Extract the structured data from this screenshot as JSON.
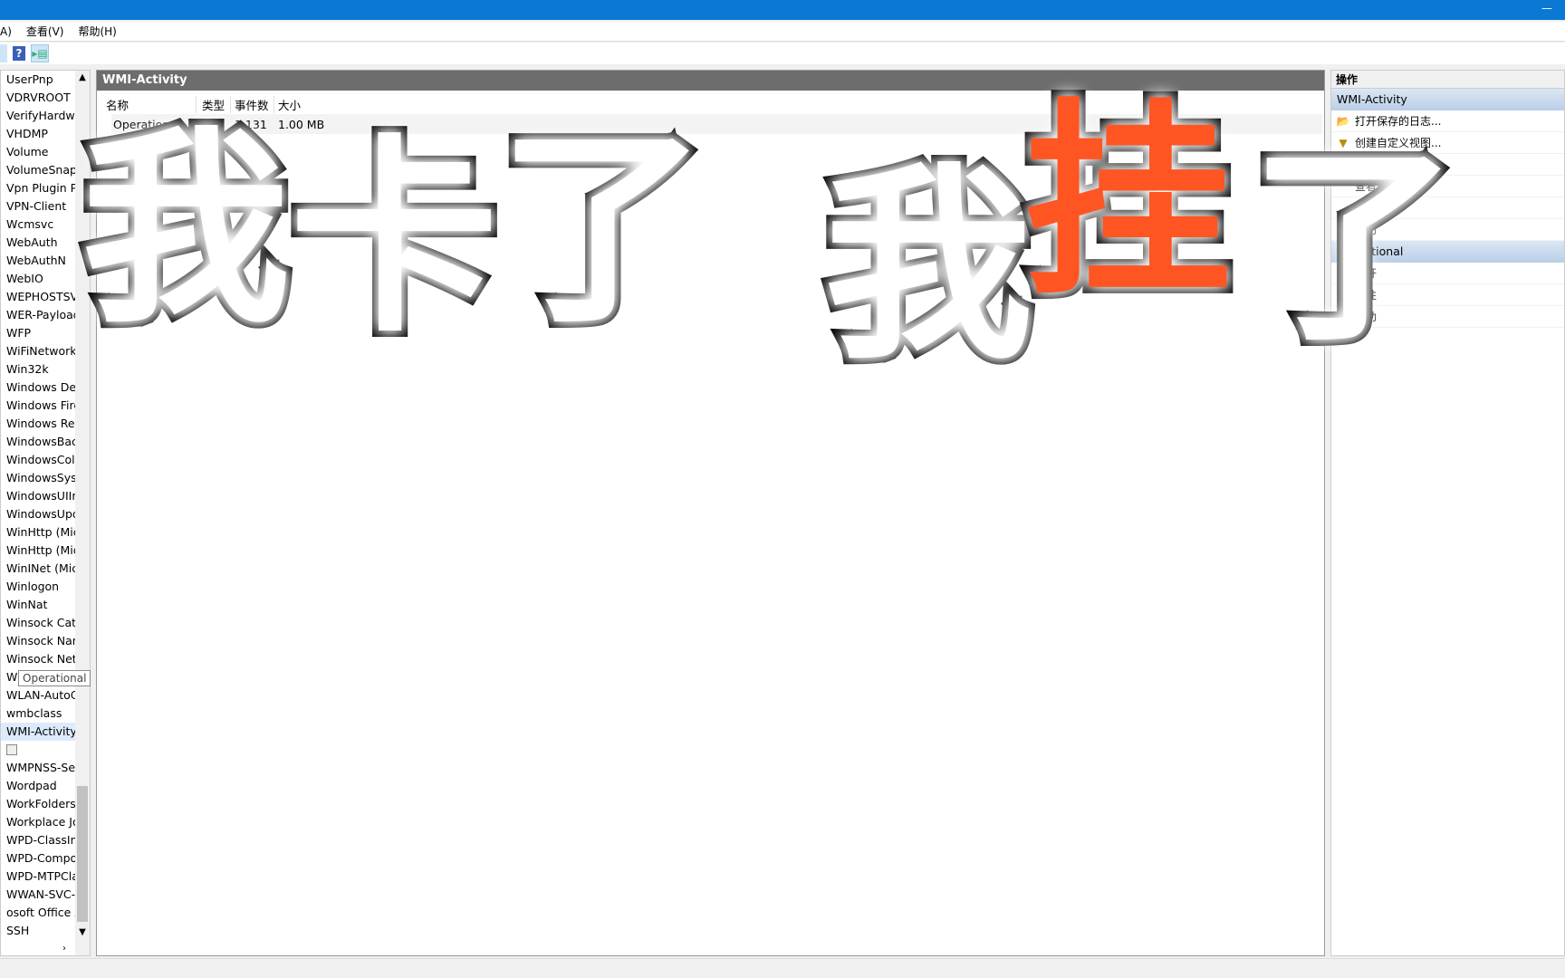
{
  "menu": [
    "A)",
    "查看(V)",
    "帮助(H)"
  ],
  "tree": {
    "items": [
      "UserPnp",
      "VDRVROOT",
      "VerifyHardwa",
      "VHDMP",
      "Volume",
      "VolumeSnaps",
      "Vpn Plugin Pl",
      "VPN-Client",
      "Wcmsvc",
      "WebAuth",
      "WebAuthN",
      "WebIO",
      "WEPHOSTSV",
      "WER-Payload",
      "WFP",
      "WiFiNetwork",
      "Win32k",
      "Windows Def",
      "Windows Fire",
      "Windows Rer",
      "WindowsBacl",
      "WindowsColc",
      "WindowsSyst",
      "WindowsUIIn",
      "WindowsUpd",
      "WinHttp (Mic",
      "WinHttp (Mic",
      "WinINet (Mic",
      "Winlogon",
      "WinNat",
      "Winsock Cata",
      "Winsock Nan",
      "Winsock Netv",
      "Wired-AutoC",
      "WLAN-AutoC",
      "wmbclass",
      "WMI-Activity"
    ],
    "selected": "WMI-Activity",
    "tooltip": "Operational",
    "items_after": [
      "WMPNSS-Ser",
      "Wordpad",
      "WorkFolders",
      "Workplace Jo",
      "WPD-ClassIn",
      "WPD-Compo",
      "WPD-MTPCla",
      "WWAN-SVC-",
      "osoft Office Ale",
      "SSH"
    ]
  },
  "center": {
    "title": "WMI-Activity",
    "columns": [
      "名称",
      "类型",
      "事件数",
      "大小"
    ],
    "rows": [
      [
        "Operational",
        "操作",
        "1,131",
        "1.00 MB"
      ]
    ]
  },
  "actions": {
    "header": "操作",
    "section1": "WMI-Activity",
    "items1": [
      {
        "icon": "folder-open-icon",
        "label": "打开保存的日志..."
      },
      {
        "icon": "filter-icon",
        "label": "创建自定义视图..."
      },
      {
        "icon": "",
        "label": "导入自定义视图..."
      },
      {
        "icon": "",
        "label": "查看"
      },
      {
        "icon": "",
        "label": ""
      },
      {
        "icon": "help-icon",
        "label": "帮助"
      }
    ],
    "section2": "Operational",
    "items2": [
      {
        "icon": "",
        "label": "打开"
      },
      {
        "icon": "properties-icon",
        "label": "属性"
      },
      {
        "icon": "help-icon",
        "label": "帮助"
      }
    ]
  },
  "overlay": {
    "chars": [
      "我",
      "卡",
      "了",
      "我",
      "挂",
      "了"
    ],
    "accent": "#ff5522"
  }
}
